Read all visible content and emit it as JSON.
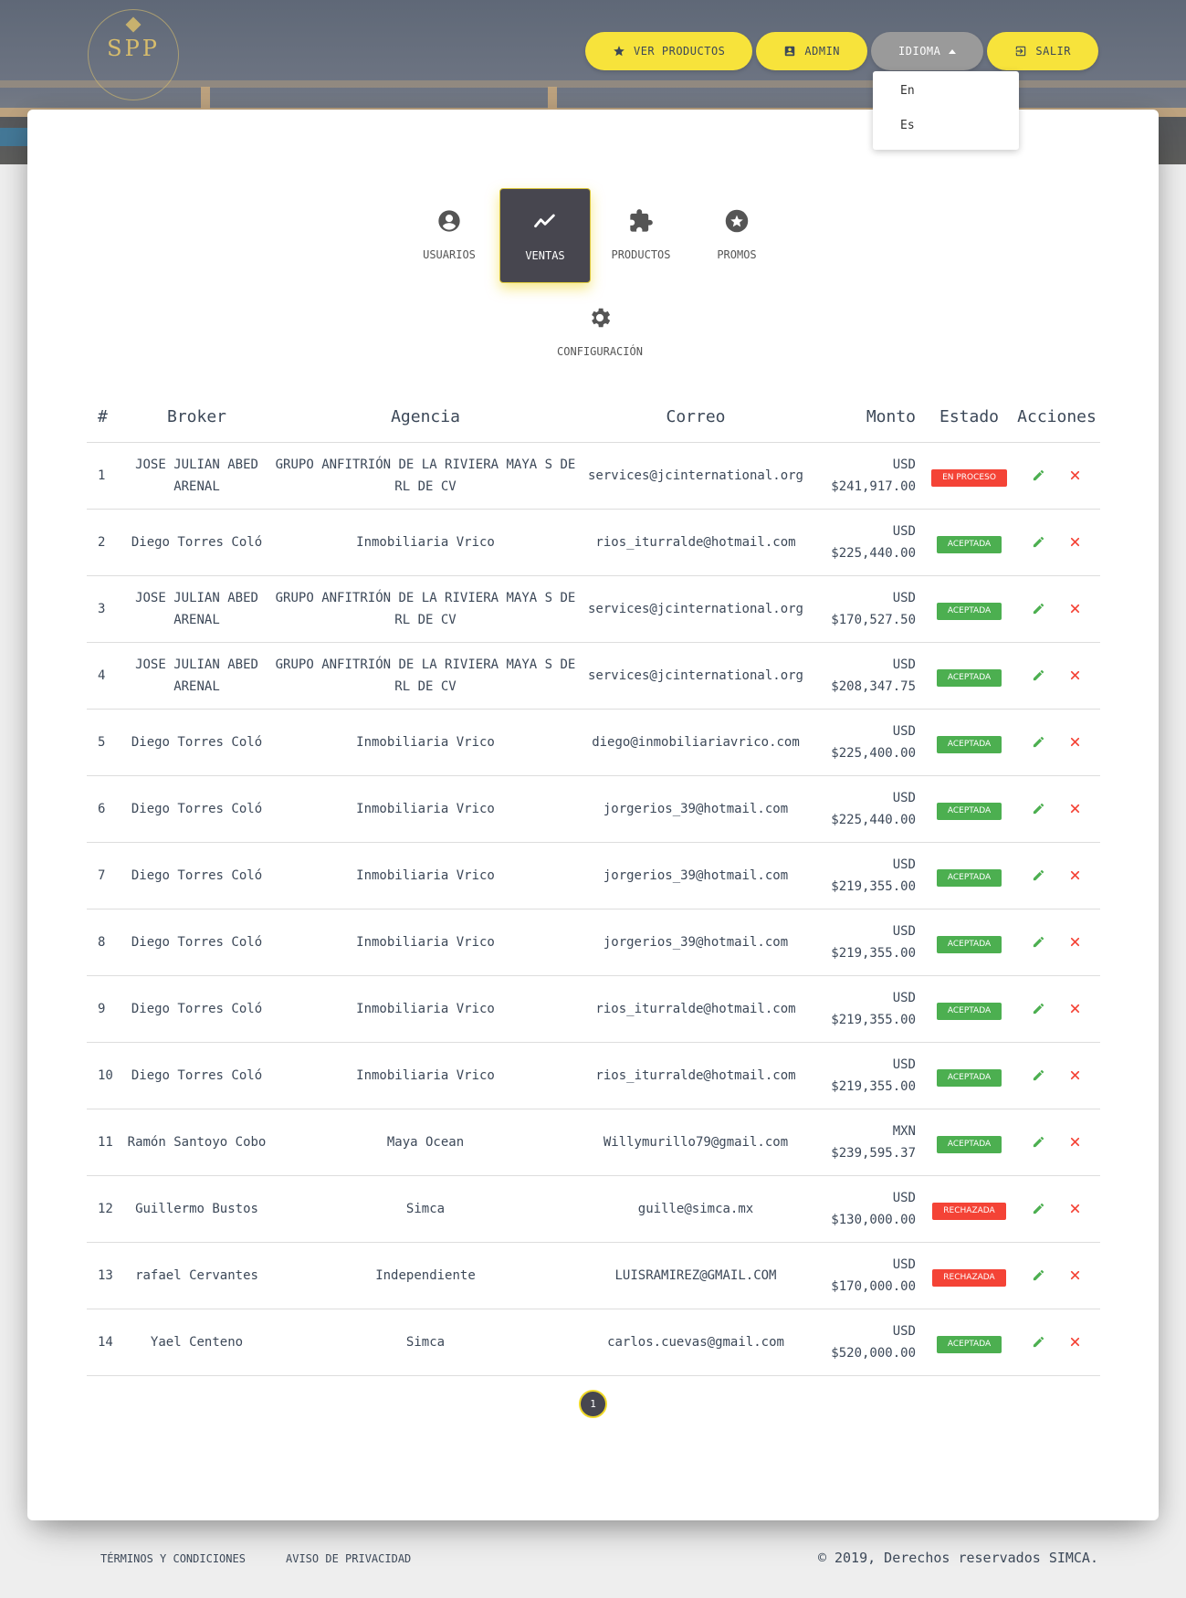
{
  "header": {
    "logo_text": "SPP",
    "nav": [
      {
        "label": "VER PRODUCTOS",
        "icon": "star-icon"
      },
      {
        "label": "ADMIN",
        "icon": "account-box-icon"
      },
      {
        "label": "IDIOMA",
        "icon": "caret-up-icon"
      },
      {
        "label": "SALIR",
        "icon": "exit-icon"
      }
    ],
    "language_options": [
      "En",
      "Es"
    ]
  },
  "tabs": [
    {
      "label": "USUARIOS",
      "icon": "user-icon"
    },
    {
      "label": "VENTAS",
      "icon": "trending-icon",
      "active": true
    },
    {
      "label": "PRODUCTOS",
      "icon": "puzzle-icon"
    },
    {
      "label": "PROMOS",
      "icon": "star-circle-icon"
    },
    {
      "label": "CONFIGURACIÓN",
      "icon": "gear-icon"
    }
  ],
  "table": {
    "columns": [
      "#",
      "Broker",
      "Agencia",
      "Correo",
      "Monto",
      "Estado",
      "Acciones"
    ],
    "rows": [
      {
        "n": "1",
        "broker": "JOSE JULIAN ABED ARENAL",
        "agencia": "GRUPO ANFITRIÓN DE LA RIVIERA MAYA S DE RL DE CV",
        "correo": "services@jcinternational.org",
        "moneda": "USD",
        "monto": "$241,917.00",
        "estado": "EN PROCESO"
      },
      {
        "n": "2",
        "broker": "Diego Torres Coló",
        "agencia": "Inmobiliaria Vrico",
        "correo": "rios_iturralde@hotmail.com",
        "moneda": "USD",
        "monto": "$225,440.00",
        "estado": "ACEPTADA"
      },
      {
        "n": "3",
        "broker": "JOSE JULIAN ABED ARENAL",
        "agencia": "GRUPO ANFITRIÓN DE LA RIVIERA MAYA S DE RL DE CV",
        "correo": "services@jcinternational.org",
        "moneda": "USD",
        "monto": "$170,527.50",
        "estado": "ACEPTADA"
      },
      {
        "n": "4",
        "broker": "JOSE JULIAN ABED ARENAL",
        "agencia": "GRUPO ANFITRIÓN DE LA RIVIERA MAYA S DE RL DE CV",
        "correo": "services@jcinternational.org",
        "moneda": "USD",
        "monto": "$208,347.75",
        "estado": "ACEPTADA"
      },
      {
        "n": "5",
        "broker": "Diego Torres Coló",
        "agencia": "Inmobiliaria Vrico",
        "correo": "diego@inmobiliariavrico.com",
        "moneda": "USD",
        "monto": "$225,400.00",
        "estado": "ACEPTADA"
      },
      {
        "n": "6",
        "broker": "Diego Torres Coló",
        "agencia": "Inmobiliaria Vrico",
        "correo": "jorgerios_39@hotmail.com",
        "moneda": "USD",
        "monto": "$225,440.00",
        "estado": "ACEPTADA"
      },
      {
        "n": "7",
        "broker": "Diego Torres Coló",
        "agencia": "Inmobiliaria Vrico",
        "correo": "jorgerios_39@hotmail.com",
        "moneda": "USD",
        "monto": "$219,355.00",
        "estado": "ACEPTADA"
      },
      {
        "n": "8",
        "broker": "Diego Torres Coló",
        "agencia": "Inmobiliaria Vrico",
        "correo": "jorgerios_39@hotmail.com",
        "moneda": "USD",
        "monto": "$219,355.00",
        "estado": "ACEPTADA"
      },
      {
        "n": "9",
        "broker": "Diego Torres Coló",
        "agencia": "Inmobiliaria Vrico",
        "correo": "rios_iturralde@hotmail.com",
        "moneda": "USD",
        "monto": "$219,355.00",
        "estado": "ACEPTADA"
      },
      {
        "n": "10",
        "broker": "Diego Torres Coló",
        "agencia": "Inmobiliaria Vrico",
        "correo": "rios_iturralde@hotmail.com",
        "moneda": "USD",
        "monto": "$219,355.00",
        "estado": "ACEPTADA"
      },
      {
        "n": "11",
        "broker": "Ramón Santoyo Cobo",
        "agencia": "Maya Ocean",
        "correo": "Willymurillo79@gmail.com",
        "moneda": "MXN",
        "monto": "$239,595.37",
        "estado": "ACEPTADA"
      },
      {
        "n": "12",
        "broker": "Guillermo Bustos",
        "agencia": "Simca",
        "correo": "guille@simca.mx",
        "moneda": "USD",
        "monto": "$130,000.00",
        "estado": "RECHAZADA"
      },
      {
        "n": "13",
        "broker": "rafael Cervantes",
        "agencia": "Independiente",
        "correo": "LUISRAMIREZ@GMAIL.COM",
        "moneda": "USD",
        "monto": "$170,000.00",
        "estado": "RECHAZADA"
      },
      {
        "n": "14",
        "broker": "Yael Centeno",
        "agencia": "Simca",
        "correo": "carlos.cuevas@gmail.com",
        "moneda": "USD",
        "monto": "$520,000.00",
        "estado": "ACEPTADA"
      }
    ]
  },
  "pagination": {
    "current": "1"
  },
  "footer": {
    "terms": "TÉRMINOS Y CONDICIONES",
    "privacy": "AVISO DE PRIVACIDAD",
    "copyright": "© 2019, Derechos reservados",
    "brand": "SIMCA."
  },
  "colors": {
    "accent_yellow": "#f7e33b",
    "tab_active": "#47464f",
    "accepted": "#4caf50",
    "rejected": "#f44336",
    "edit_icon": "#4caf50",
    "delete_icon": "#f44336"
  }
}
